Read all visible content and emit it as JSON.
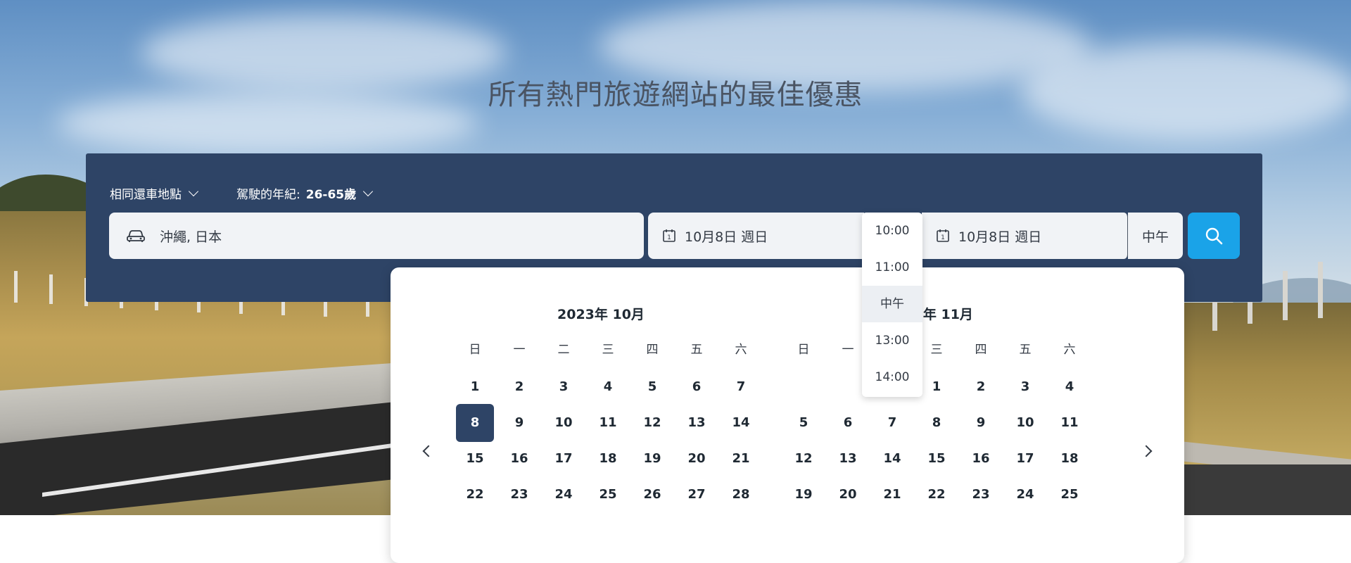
{
  "hero": {
    "headline": "所有熱門旅遊網站的最佳優惠"
  },
  "options": {
    "return_location": "相同還車地點",
    "driver_age_label": "駕駛的年紀:",
    "driver_age_value": "26-65歲"
  },
  "search": {
    "location_value": "沖繩, 日本",
    "pickup_date": "10月8日 週日",
    "dropoff_date": "10月8日 週日",
    "dropoff_time": "中午",
    "calendar_icon_number": "1"
  },
  "time_dropdown": {
    "options": [
      "10:00",
      "11:00",
      "中午",
      "13:00",
      "14:00"
    ],
    "selected": "中午"
  },
  "calendar": {
    "weekdays": [
      "日",
      "一",
      "二",
      "三",
      "四",
      "五",
      "六"
    ],
    "months": [
      {
        "title": "2023年 10月",
        "first_weekday": 0,
        "days": 28,
        "selected_day": 8
      },
      {
        "title": "2023年 11月",
        "first_weekday": 3,
        "days": 25,
        "selected_day": null
      }
    ]
  },
  "colors": {
    "panel": "#2e4466",
    "search_button": "#1aa3e8",
    "selected_day": "#2e4466"
  },
  "icons": {
    "location": "car-icon",
    "date": "calendar-icon",
    "search": "search-icon",
    "prev": "chevron-left-icon",
    "next": "chevron-right-icon"
  }
}
